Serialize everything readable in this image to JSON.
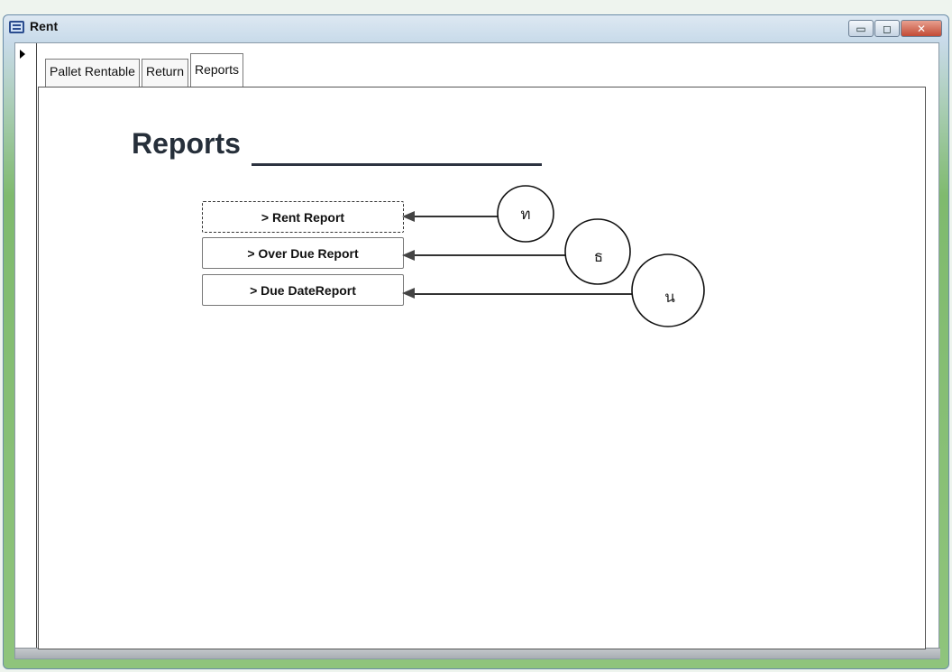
{
  "window": {
    "title": "Rent",
    "app_icon": "form-icon",
    "controls": {
      "minimize": "▭",
      "maximize": "◻",
      "close": "✕"
    }
  },
  "tabs": [
    {
      "label": "Pallet Rentable",
      "active": false
    },
    {
      "label": "Return",
      "active": false
    },
    {
      "label": "Reports",
      "active": true
    }
  ],
  "reports_page": {
    "heading": "Reports",
    "buttons": [
      {
        "label": "> Rent Report",
        "focused": true
      },
      {
        "label": "> Over Due Report",
        "focused": false
      },
      {
        "label": "> Due DateReport",
        "focused": false
      }
    ]
  },
  "annotations": [
    {
      "marker": "ท",
      "points_to": "> Rent Report"
    },
    {
      "marker": "ธ",
      "points_to": "> Over Due Report"
    },
    {
      "marker": "น",
      "points_to": "> Due DateReport"
    }
  ]
}
